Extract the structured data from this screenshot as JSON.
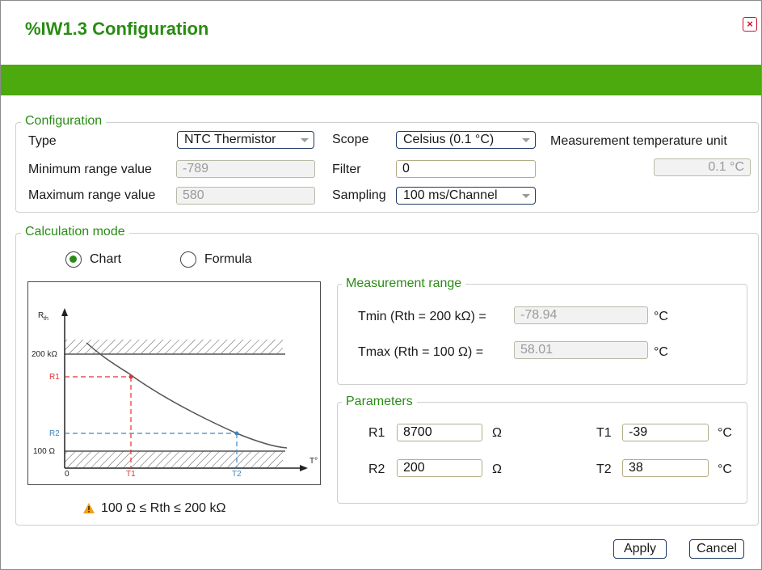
{
  "window": {
    "title": "%IW1.3 Configuration",
    "close_label": "×"
  },
  "configuration": {
    "legend": "Configuration",
    "type_label": "Type",
    "type_value": "NTC Thermistor",
    "scope_label": "Scope",
    "scope_value": "Celsius (0.1 °C)",
    "unit_label": "Measurement temperature unit",
    "unit_value": "0.1 °C",
    "min_label": "Minimum range value",
    "min_value": "-789",
    "filter_label": "Filter",
    "filter_value": "0",
    "max_label": "Maximum range value",
    "max_value": "580",
    "sampling_label": "Sampling",
    "sampling_value": "100 ms/Channel"
  },
  "calculation": {
    "legend": "Calculation mode",
    "mode_chart": "Chart",
    "mode_formula": "Formula",
    "selected_mode": "Chart",
    "condition": "100 Ω ≤ Rth ≤ 200 kΩ"
  },
  "chart_diagram": {
    "y_axis_label": "R",
    "y_axis_sub": "th",
    "x_axis_label": "T°",
    "y_ticks": [
      "200 kΩ",
      "R1",
      "R2",
      "100 Ω"
    ],
    "x_ticks": [
      "0",
      "T1",
      "T2"
    ],
    "colors": {
      "r1_line": "#e83030",
      "r2_line": "#3a86c8",
      "curve": "#555555",
      "hatch": "#555555"
    }
  },
  "measurement_range": {
    "legend": "Measurement range",
    "tmin_label": "Tmin (Rth = 200 kΩ) =",
    "tmin_value": "-78.94",
    "tmin_unit": "°C",
    "tmax_label": "Tmax (Rth = 100 Ω) =",
    "tmax_value": "58.01",
    "tmax_unit": "°C"
  },
  "parameters": {
    "legend": "Parameters",
    "r1_label": "R1",
    "r1_value": "8700",
    "r1_unit": "Ω",
    "r2_label": "R2",
    "r2_value": "200",
    "r2_unit": "Ω",
    "t1_label": "T1",
    "t1_value": "-39",
    "t1_unit": "°C",
    "t2_label": "T2",
    "t2_value": "38",
    "t2_unit": "°C"
  },
  "buttons": {
    "apply": "Apply",
    "cancel": "Cancel"
  },
  "colors": {
    "accent": "#4caa0f",
    "title": "#2a8c14",
    "button_border": "#1f3a66"
  }
}
